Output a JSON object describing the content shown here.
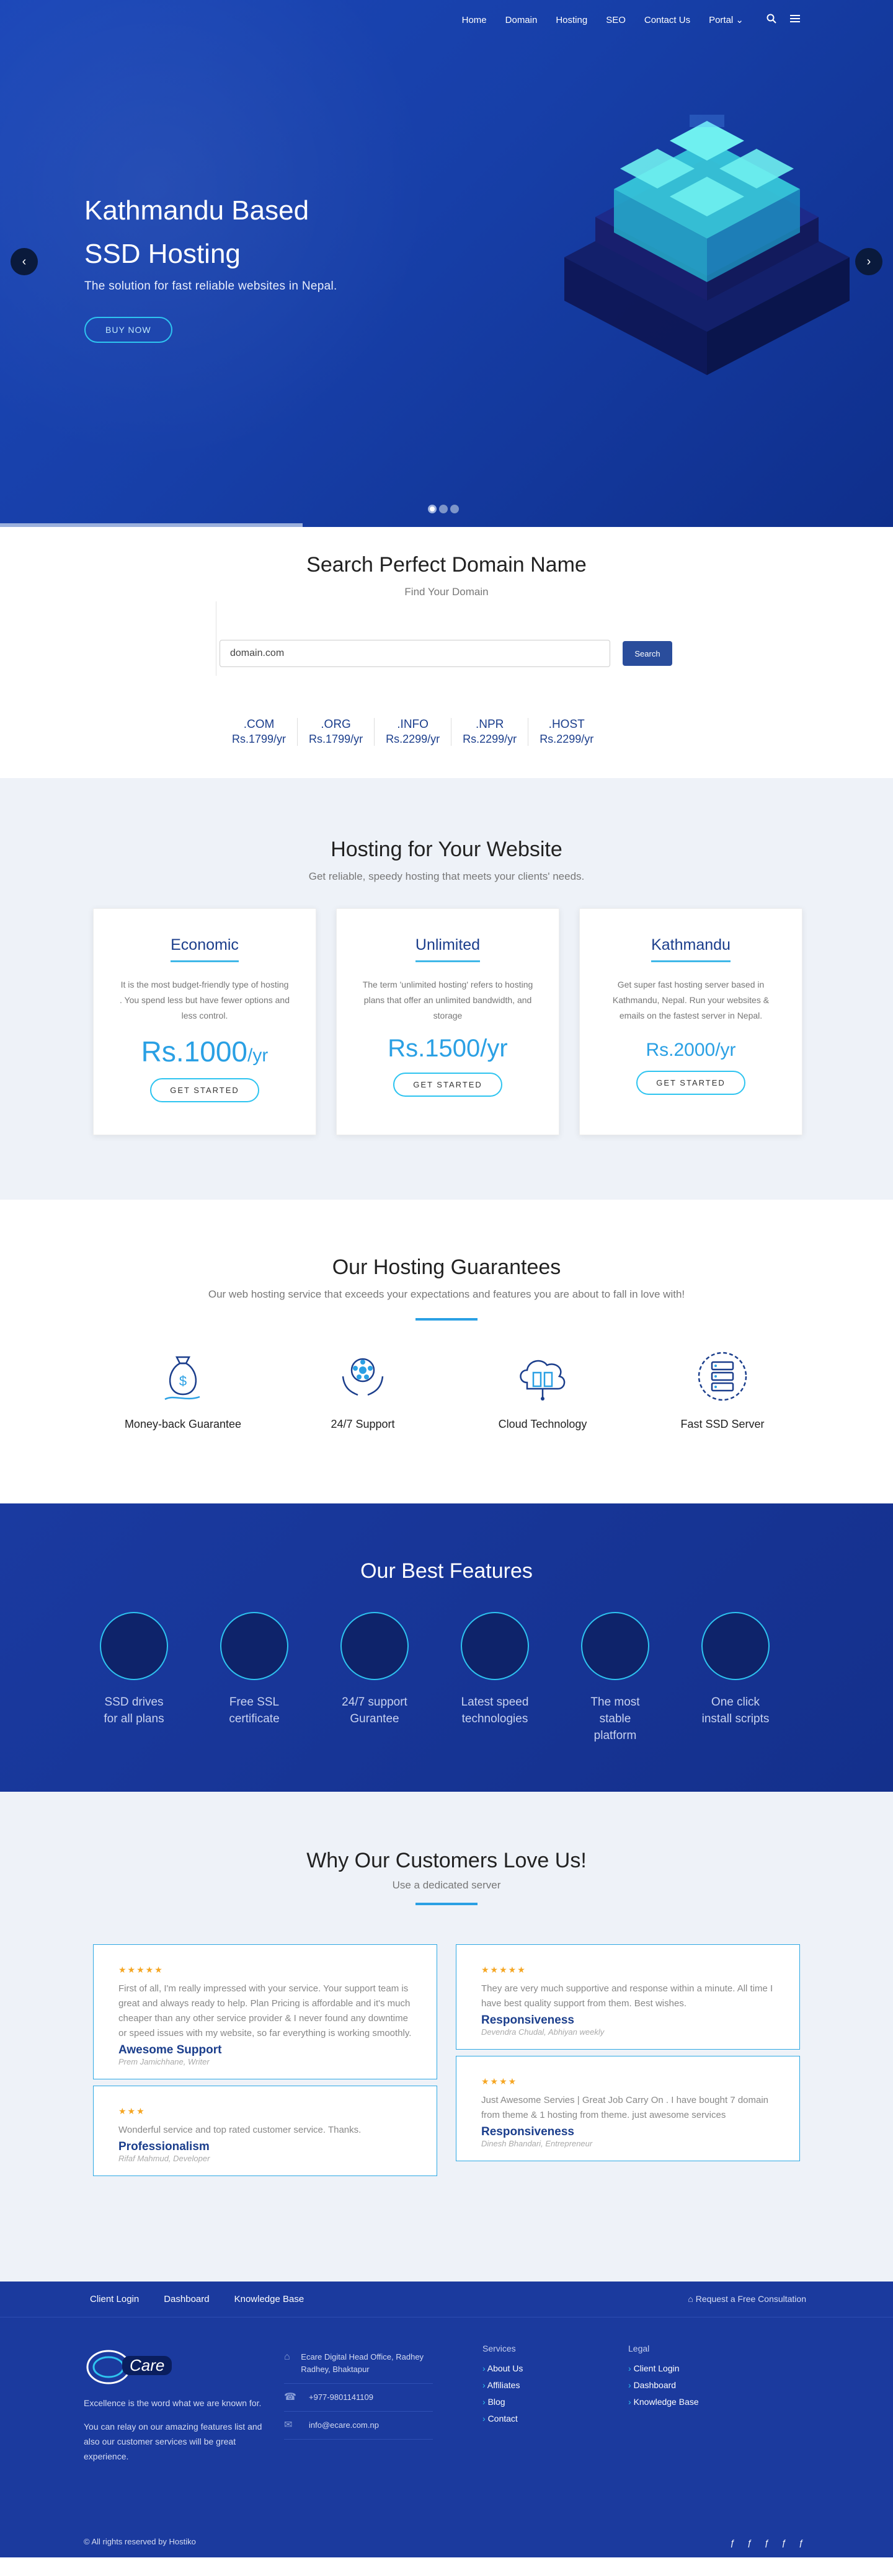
{
  "nav": {
    "items": [
      "Home",
      "Domain",
      "Hosting",
      "SEO",
      "Contact Us",
      "Portal ⌄"
    ],
    "search_icon": "search-icon",
    "menu_icon": "menu-icon"
  },
  "hero": {
    "title_line1": "Kathmandu Based",
    "title_line2": "SSD Hosting",
    "subtitle": "The solution for fast reliable websites in Nepal.",
    "button": "BUY NOW",
    "prev": "‹",
    "next": "›"
  },
  "domain": {
    "title": "Search Perfect Domain Name",
    "subtitle": "Find Your Domain",
    "placeholder": "domain.com",
    "button": "Search",
    "tlds": [
      {
        "name": ".COM",
        "price": "Rs.1799/yr"
      },
      {
        "name": ".ORG",
        "price": "Rs.1799/yr"
      },
      {
        "name": ".INFO",
        "price": "Rs.2299/yr"
      },
      {
        "name": ".NPR",
        "price": "Rs.2299/yr"
      },
      {
        "name": ".HOST",
        "price": "Rs.2299/yr"
      }
    ]
  },
  "hosting": {
    "title": "Hosting for Your Website",
    "subtitle": "Get reliable, speedy hosting that meets your clients' needs.",
    "plans": [
      {
        "name": "Economic",
        "desc": "It is the most budget-friendly type of hosting . You spend less but have fewer options and less control.",
        "price": "Rs.1000",
        "unit": "/yr",
        "button": "GET STARTED"
      },
      {
        "name": "Unlimited",
        "desc": "The term 'unlimited hosting' refers to hosting plans that offer an unlimited bandwidth, and storage",
        "price": "Rs.1500/yr",
        "button": "GET STARTED"
      },
      {
        "name": "Kathmandu",
        "desc": "Get super fast hosting server based in Kathmandu, Nepal. Run your websites & emails on the fastest server in Nepal.",
        "price": "Rs.2000/yr",
        "button": "GET STARTED"
      }
    ]
  },
  "guarantees": {
    "title": "Our Hosting Guarantees",
    "subtitle": "Our web hosting service that exceeds your expectations and features you are about to fall in love with!",
    "items": [
      "Money-back Guarantee",
      "24/7 Support",
      "Cloud Technology",
      "Fast SSD Server"
    ]
  },
  "features": {
    "title": "Our Best Features",
    "items": [
      {
        "l1": "SSD drives",
        "l2": "for all plans"
      },
      {
        "l1": "Free SSL",
        "l2": "certificate"
      },
      {
        "l1": "24/7 support",
        "l2": "Gurantee"
      },
      {
        "l1": "Latest speed",
        "l2": "technologies"
      },
      {
        "l1": "The most",
        "l2": "stable platform"
      },
      {
        "l1": "One click",
        "l2": "install scripts"
      }
    ]
  },
  "testimonials": {
    "title": "Why Our Customers Love Us!",
    "subtitle": "Use a dedicated server",
    "left": [
      {
        "stars": "★★★★★",
        "text": "First of all, I'm really impressed with your service. Your support team is great and always ready to help. Plan Pricing is affordable and it's much cheaper than any other service provider & I never found any downtime or speed issues with my website, so far everything is working smoothly.",
        "name": "Awesome Support",
        "role": "Prem Jamichhane, Writer"
      },
      {
        "stars": "★★★",
        "text": "Wonderful service and top rated customer service. Thanks.",
        "name": "Professionalism",
        "role": "Rifaf Mahmud, Developer"
      }
    ],
    "right": [
      {
        "stars": "★★★★★",
        "text": "They are very much supportive and response within a minute. All time I have best quality support from them. Best wishes.",
        "name": "Responsiveness",
        "role": "Devendra Chudal, Abhiyan weekly"
      },
      {
        "stars": "★★★★",
        "text": "Just Awesome Servies | Great Job Carry On . I have bought 7 domain from theme & 1 hosting from theme. just awesome services",
        "name": "Responsiveness",
        "role": "Dinesh Bhandari, Entrepreneur"
      }
    ]
  },
  "footer": {
    "top_links": [
      "Client Login",
      "Dashboard",
      "Knowledge Base"
    ],
    "consult": "Request a Free Consultation",
    "logo": "Care",
    "about1": "Excellence is the word what we are known for.",
    "about2": "You can relay on our amazing features list and also our customer services will be great experience.",
    "address": "Ecare Digital Head Office, Radhey Radhey, Bhaktapur",
    "phone": "+977-9801141109",
    "email": "info@ecare.com.np",
    "services_title": "Services",
    "services": [
      "About Us",
      "Affiliates",
      "Blog",
      "Contact"
    ],
    "legal_title": "Legal",
    "legal": [
      "Client Login",
      "Dashboard",
      "Knowledge Base"
    ],
    "copyright": "© All rights reserved by Hostiko",
    "social": "ƒ ƒ ƒ ƒ ƒ"
  }
}
